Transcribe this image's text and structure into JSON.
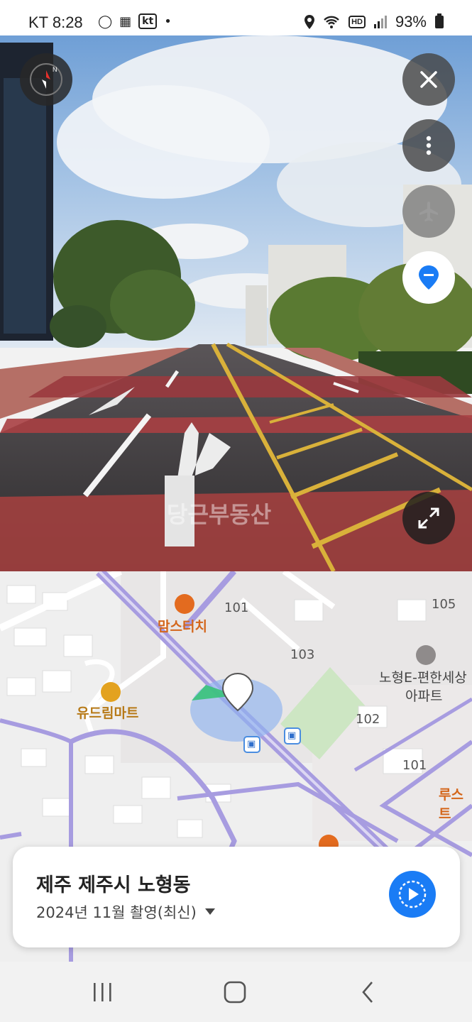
{
  "status_bar": {
    "carrier": "KT",
    "time": "8:28",
    "kt_badge": "kt",
    "hd_badge": "HD",
    "battery": "93%"
  },
  "street_view": {
    "watermark": "당근부동산"
  },
  "map": {
    "poi_mamsteochi": "맘스터치",
    "poi_udream_mart": "유드림마트",
    "poi_apartment_line1": "노형E-편한세상",
    "poi_apartment_line2": "아파트",
    "poi_rooster": "루스트",
    "building_101_top": "101",
    "building_103": "103",
    "building_105": "105",
    "building_102": "102",
    "building_101_bottom": "101"
  },
  "location_card": {
    "title": "제주 제주시 노형동",
    "capture_date": "2024년 11월 촬영(최신)"
  },
  "colors": {
    "accent_blue": "#1a7cf5",
    "map_road": "#a79ce0",
    "poi_orange": "#e36b1f"
  }
}
